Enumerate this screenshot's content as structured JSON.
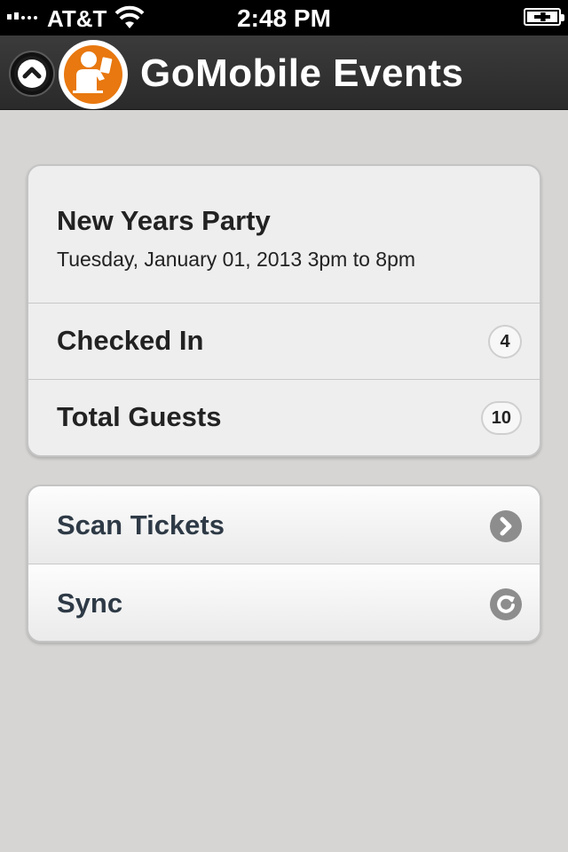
{
  "status_bar": {
    "carrier": "AT&T",
    "time": "2:48 PM"
  },
  "header": {
    "title": "GoMobile Events"
  },
  "event": {
    "title": "New Years Party",
    "date": "Tuesday, January 01, 2013 3pm to 8pm"
  },
  "stats": {
    "checked_in_label": "Checked In",
    "checked_in_count": "4",
    "total_guests_label": "Total Guests",
    "total_guests_count": "10"
  },
  "actions": {
    "scan_label": "Scan Tickets",
    "sync_label": "Sync"
  },
  "colors": {
    "brand_orange": "#e8780f",
    "background": "#d6d5d3",
    "header": "#2f2f2f"
  },
  "icons": {
    "signal": "signal-icon",
    "wifi": "wifi-icon",
    "battery": "battery-icon",
    "up": "chevron-up-icon",
    "logo": "person-ticket-icon",
    "scan": "chevron-right-icon",
    "sync": "refresh-icon"
  }
}
